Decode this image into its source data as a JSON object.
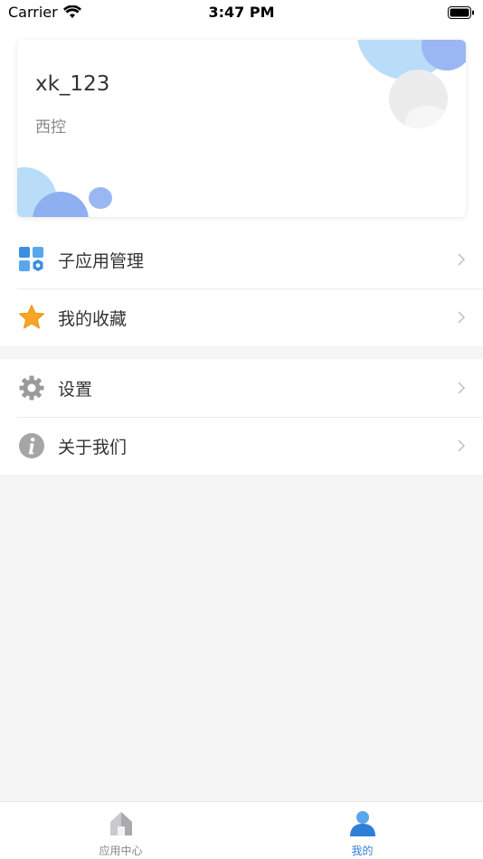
{
  "status_bar": {
    "carrier": "Carrier",
    "time": "3:47 PM",
    "wifi_icon": "wifi-icon",
    "battery_icon": "battery-icon"
  },
  "profile": {
    "username": "xk_123",
    "organization": "西控",
    "avatar_icon": "avatar-placeholder"
  },
  "menu": {
    "group1": [
      {
        "label": "子应用管理",
        "icon": "apps-grid-icon"
      },
      {
        "label": "我的收藏",
        "icon": "star-icon"
      }
    ],
    "group2": [
      {
        "label": "设置",
        "icon": "gear-icon"
      },
      {
        "label": "关于我们",
        "icon": "info-icon"
      }
    ]
  },
  "tab_bar": {
    "tabs": [
      {
        "label": "应用中心",
        "icon": "home-icon",
        "active": false
      },
      {
        "label": "我的",
        "icon": "person-icon",
        "active": true
      }
    ],
    "active_color": "#2f7fd8",
    "inactive_color": "#888888"
  },
  "colors": {
    "accent_blue": "#2f7fd8",
    "star_yellow": "#f5a623",
    "icon_gray": "#9a9a9a"
  }
}
